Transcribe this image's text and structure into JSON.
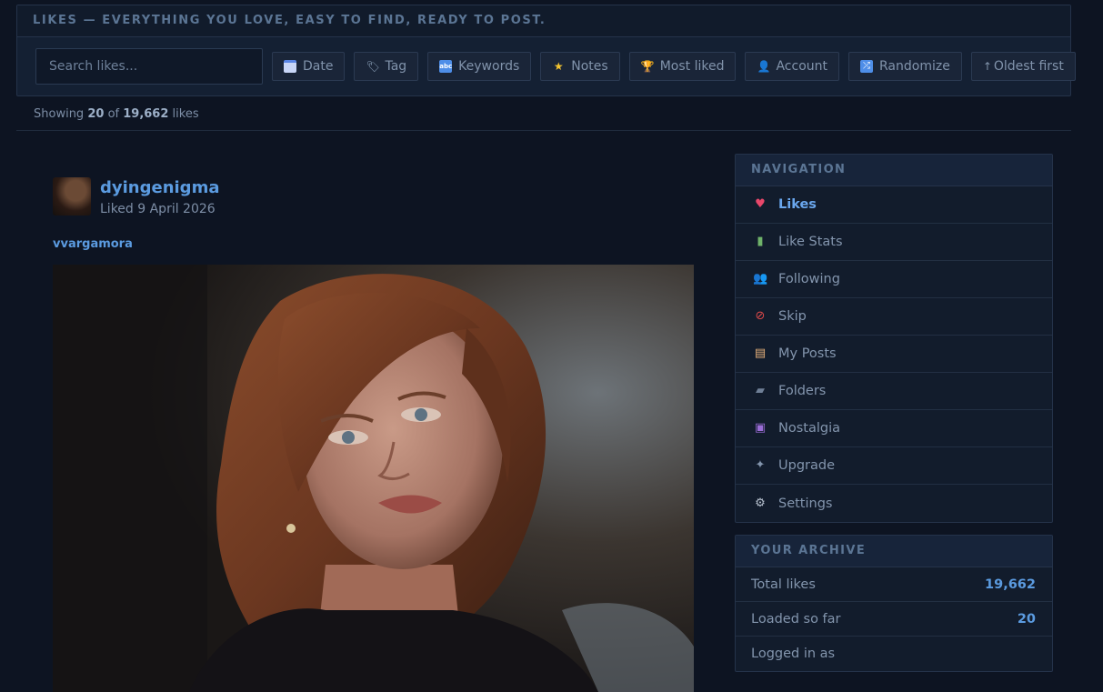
{
  "header": {
    "tagline": "LIKES — EVERYTHING YOU LOVE, EASY TO FIND, READY TO POST."
  },
  "toolbar": {
    "search_placeholder": "Search likes...",
    "buttons": [
      {
        "label": "Date",
        "icon": "calendar-icon"
      },
      {
        "label": "Tag",
        "icon": "tag-icon"
      },
      {
        "label": "Keywords",
        "icon": "abc-icon"
      },
      {
        "label": "Notes",
        "icon": "star-icon"
      },
      {
        "label": "Most liked",
        "icon": "trophy-icon"
      },
      {
        "label": "Account",
        "icon": "account-icon"
      },
      {
        "label": "Randomize",
        "icon": "shuffle-icon"
      },
      {
        "label": "Oldest first",
        "icon": "arrow-up-icon"
      }
    ]
  },
  "summary": {
    "prefix": "Showing",
    "shown": "20",
    "of": "of",
    "total": "19,662",
    "suffix": "likes"
  },
  "post": {
    "username": "dyingenigma",
    "liked_date": "Liked 9 April 2026",
    "reblogged_from": "vvargamora"
  },
  "sidebar": {
    "nav_title": "NAVIGATION",
    "nav_items": [
      {
        "label": "Likes",
        "icon": "heart-icon",
        "active": true
      },
      {
        "label": "Like Stats",
        "icon": "bar-chart-icon"
      },
      {
        "label": "Following",
        "icon": "people-icon"
      },
      {
        "label": "Skip",
        "icon": "prohibited-icon"
      },
      {
        "label": "My Posts",
        "icon": "document-icon"
      },
      {
        "label": "Folders",
        "icon": "folder-icon"
      },
      {
        "label": "Nostalgia",
        "icon": "ticket-icon"
      },
      {
        "label": "Upgrade",
        "icon": "sparkle-icon"
      },
      {
        "label": "Settings",
        "icon": "gear-icon"
      }
    ],
    "archive_title": "YOUR ARCHIVE",
    "archive_rows": [
      {
        "label": "Total likes",
        "value": "19,662"
      },
      {
        "label": "Loaded so far",
        "value": "20"
      },
      {
        "label": "Logged in as",
        "value": ""
      }
    ]
  },
  "colors": {
    "background": "#0d1422",
    "accent": "#5b9be0",
    "panel": "#121c2c"
  }
}
